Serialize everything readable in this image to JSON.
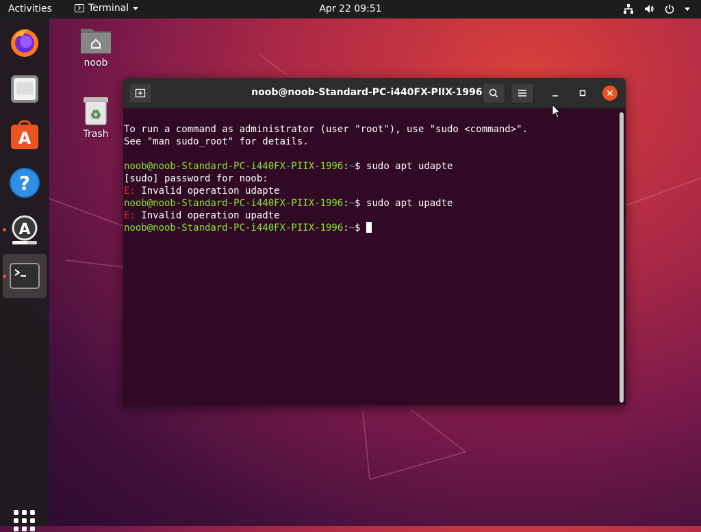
{
  "topbar": {
    "activities": "Activities",
    "app_name": "Terminal",
    "clock": "Apr 22  09:51"
  },
  "desktop": {
    "home_label": "noob",
    "trash_label": "Trash"
  },
  "dock": {
    "items": [
      "firefox-icon",
      "files-icon",
      "ubuntu-software-icon",
      "help-icon",
      "software-updater-icon",
      "terminal-icon"
    ]
  },
  "terminal": {
    "title": "noob@noob-Standard-PC-i440FX-PIIX-1996: ~",
    "lines": {
      "l1": "To run a command as administrator (user \"root\"), use \"sudo <command>\".",
      "l2": "See \"man sudo_root\" for details.",
      "prompt_user": "noob@noob-Standard-PC-i440FX-PIIX-1996",
      "prompt_colon": ":",
      "prompt_path": "~",
      "prompt_dollar": "$ ",
      "cmd1": "sudo apt udapte",
      "sudo_prompt": "[sudo] password for noob:",
      "err_prefix": "E: ",
      "err1": "Invalid operation udapte",
      "cmd2": "sudo apt upadte",
      "err2": "Invalid operation upadte"
    }
  },
  "colors": {
    "accent": "#e95420",
    "terminal_bg": "#300a24",
    "prompt_green": "#8ae234",
    "path_blue": "#729fcf",
    "error_red": "#ef2929"
  }
}
